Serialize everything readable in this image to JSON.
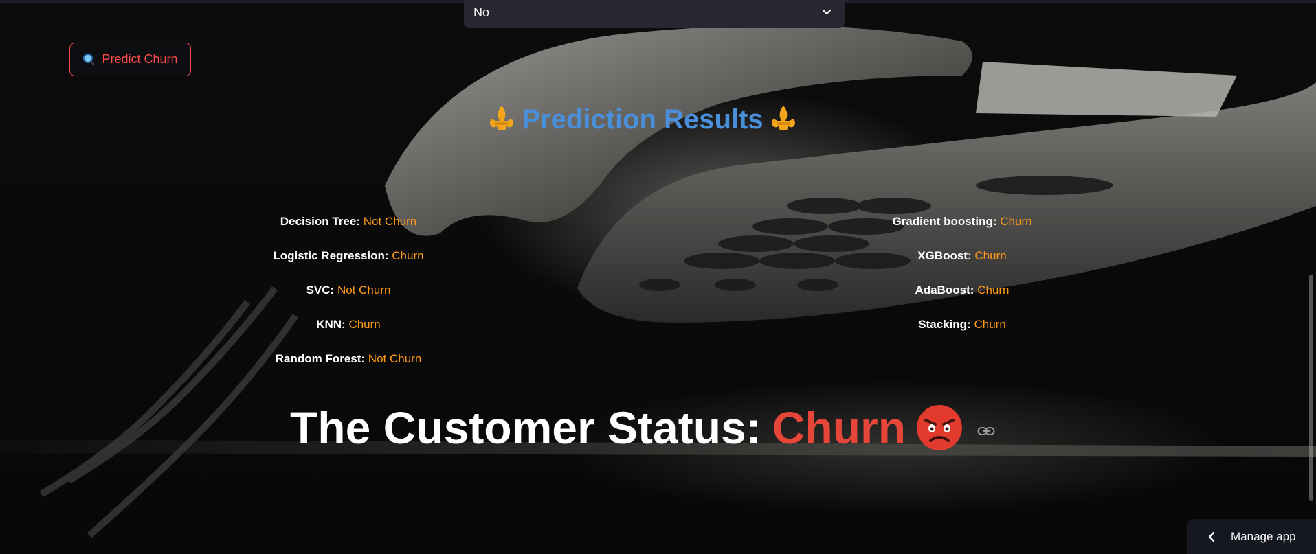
{
  "select": {
    "value": "No",
    "icon": "chevron-down-icon"
  },
  "predict_button": {
    "label": "Predict Churn",
    "icon": "magnifier-icon"
  },
  "results": {
    "title": "Prediction Results",
    "icon": "fleur-de-lis-icon",
    "left": [
      {
        "model": "Decision Tree:",
        "result": "Not Churn"
      },
      {
        "model": "Logistic Regression:",
        "result": "Churn"
      },
      {
        "model": "SVC:",
        "result": "Not Churn"
      },
      {
        "model": "KNN:",
        "result": "Churn"
      },
      {
        "model": "Random Forest:",
        "result": "Not Churn"
      }
    ],
    "right": [
      {
        "model": "Gradient boosting:",
        "result": "Churn"
      },
      {
        "model": "XGBoost:",
        "result": "Churn"
      },
      {
        "model": "AdaBoost:",
        "result": "Churn"
      },
      {
        "model": "Stacking:",
        "result": "Churn"
      }
    ]
  },
  "status": {
    "label": "The Customer Status:",
    "value": "Churn",
    "emoji": "angry-face-icon",
    "anchor_icon": "link-icon"
  },
  "manage_app": {
    "label": "Manage app",
    "icon": "chevron-left-icon"
  },
  "colors": {
    "accent": "#ff4b4b",
    "title_blue": "#4a8fd9",
    "result_orange": "#ff9b1a",
    "churn_red": "#e6453a"
  }
}
